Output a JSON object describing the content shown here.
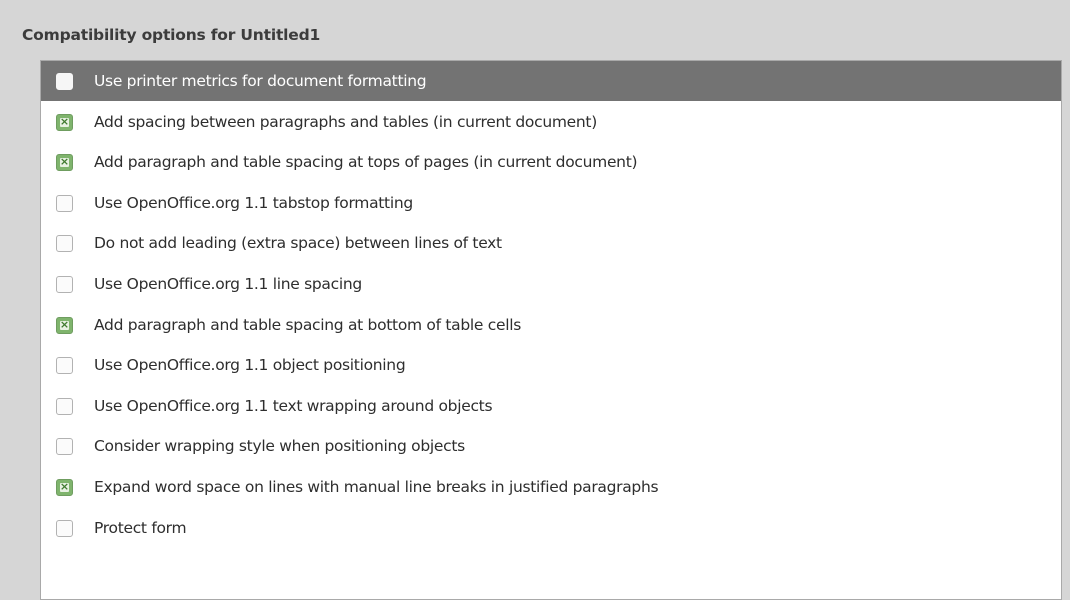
{
  "section": {
    "title": "Compatibility options for Untitled1"
  },
  "options": [
    {
      "label": "Use printer metrics for document formatting",
      "checked": false,
      "selected": true
    },
    {
      "label": "Add spacing between paragraphs and tables (in current document)",
      "checked": true,
      "selected": false
    },
    {
      "label": "Add paragraph and table spacing at tops of pages (in current document)",
      "checked": true,
      "selected": false
    },
    {
      "label": "Use OpenOffice.org 1.1 tabstop formatting",
      "checked": false,
      "selected": false
    },
    {
      "label": "Do not add leading (extra space) between lines of text",
      "checked": false,
      "selected": false
    },
    {
      "label": "Use OpenOffice.org 1.1 line spacing",
      "checked": false,
      "selected": false
    },
    {
      "label": "Add paragraph and table spacing at bottom of table cells",
      "checked": true,
      "selected": false
    },
    {
      "label": "Use OpenOffice.org 1.1 object positioning",
      "checked": false,
      "selected": false
    },
    {
      "label": "Use OpenOffice.org 1.1 text wrapping around objects",
      "checked": false,
      "selected": false
    },
    {
      "label": "Consider wrapping style when positioning objects",
      "checked": false,
      "selected": false
    },
    {
      "label": "Expand word space on lines with manual line breaks in justified paragraphs",
      "checked": true,
      "selected": false
    },
    {
      "label": "Protect form",
      "checked": false,
      "selected": false
    }
  ],
  "colors": {
    "selected_row": "#737373",
    "checked_box": "#7fb46d",
    "background": "#d6d6d6"
  }
}
